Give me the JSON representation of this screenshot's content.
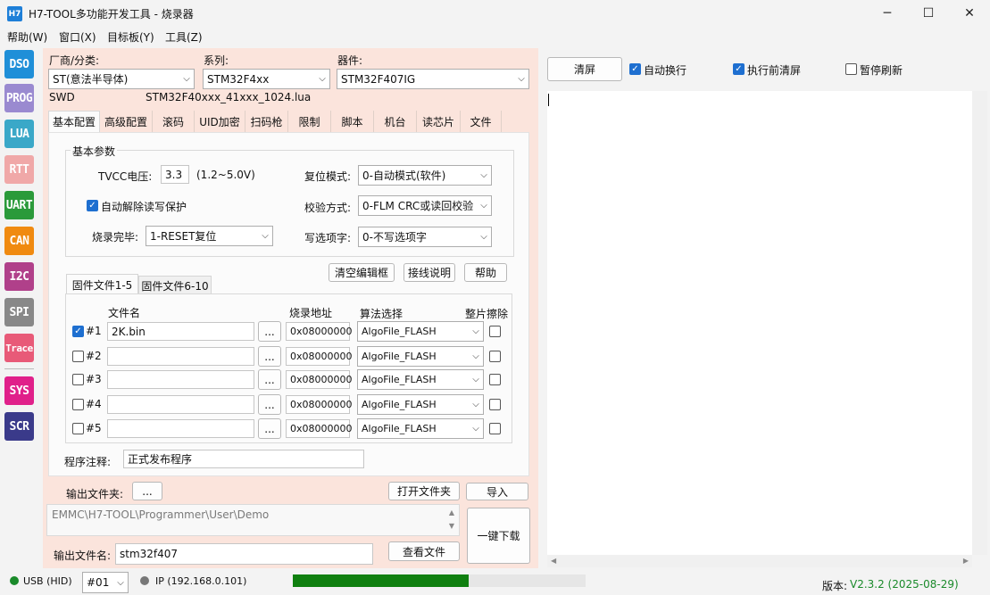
{
  "window": {
    "logo": "H7",
    "title": "H7-TOOL多功能开发工具 - 烧录器",
    "minimize": "─",
    "maximize": "☐",
    "close": "✕"
  },
  "menu": [
    "帮助(W)",
    "窗口(X)",
    "目标板(Y)",
    "工具(Z)"
  ],
  "sidebar": [
    {
      "label": "DSO",
      "color": "#1f8fd8"
    },
    {
      "label": "PROG",
      "color": "#9a8ad0"
    },
    {
      "label": "LUA",
      "color": "#3aa8c8"
    },
    {
      "label": "RTT",
      "color": "#f0a8a8"
    },
    {
      "label": "UART",
      "color": "#2a9a3a"
    },
    {
      "label": "CAN",
      "color": "#f08a10"
    },
    {
      "label": "I2C",
      "color": "#b0408a"
    },
    {
      "label": "SPI",
      "color": "#888888"
    },
    {
      "label": "Trace",
      "color": "#e85a78"
    },
    {
      "label": "SYS",
      "color": "#e0208a"
    },
    {
      "label": "SCR",
      "color": "#3a3a8a"
    }
  ],
  "device": {
    "vendor_label": "厂商/分类:",
    "vendor": "ST(意法半导体)",
    "series_label": "系列:",
    "series": "STM32F4xx",
    "part_label": "器件:",
    "part": "STM32F407IG",
    "interface": "SWD",
    "script": "STM32F40xxx_41xxx_1024.lua"
  },
  "tabs": [
    "基本配置",
    "高级配置",
    "滚码",
    "UID加密",
    "扫码枪",
    "限制",
    "脚本",
    "机台",
    "读芯片",
    "文件"
  ],
  "basic": {
    "group_title": "基本参数",
    "tvcc_label": "TVCC电压:",
    "tvcc": "3.3",
    "tvcc_range": "(1.2~5.0V)",
    "reset_label": "复位模式:",
    "reset": "0-自动模式(软件)",
    "unlock_label": "自动解除读写保护",
    "verify_label": "校验方式:",
    "verify": "0-FLM CRC或读回校验",
    "finish_label": "烧录完毕:",
    "finish": "1-RESET复位",
    "option_label": "写选项字:",
    "option": "0-不写选项字"
  },
  "actions": {
    "clear_editor": "清空编辑框",
    "wiring": "接线说明",
    "help": "帮助"
  },
  "fw_tabs": [
    "固件文件1-5",
    "固件文件6-10"
  ],
  "fw_headers": {
    "file": "文件名",
    "addr": "烧录地址",
    "algo": "算法选择",
    "erase": "整片擦除"
  },
  "fw_rows": [
    {
      "id": "#1",
      "checked": true,
      "file": "2K.bin",
      "browse": "...",
      "addr": "0x08000000",
      "algo": "AlgoFile_FLASH"
    },
    {
      "id": "#2",
      "checked": false,
      "file": "",
      "browse": "...",
      "addr": "0x08000000",
      "algo": "AlgoFile_FLASH"
    },
    {
      "id": "#3",
      "checked": false,
      "file": "",
      "browse": "...",
      "addr": "0x08000000",
      "algo": "AlgoFile_FLASH"
    },
    {
      "id": "#4",
      "checked": false,
      "file": "",
      "browse": "...",
      "addr": "0x08000000",
      "algo": "AlgoFile_FLASH"
    },
    {
      "id": "#5",
      "checked": false,
      "file": "",
      "browse": "...",
      "addr": "0x08000000",
      "algo": "AlgoFile_FLASH"
    }
  ],
  "note_label": "程序注释:",
  "note": "正式发布程序",
  "output": {
    "folder_label": "输出文件夹:",
    "folder_browse": "...",
    "open_folder": "打开文件夹",
    "import": "导入",
    "path": "EMMC\\H7-TOOL\\Programmer\\User\\Demo",
    "name_label": "输出文件名:",
    "name": "stm32f407",
    "view_file": "查看文件",
    "download": "一键下载"
  },
  "right": {
    "clear": "清屏",
    "auto_wrap": "自动换行",
    "clear_before": "执行前清屏",
    "pause": "暂停刷新"
  },
  "status": {
    "usb": "USB (HID)",
    "port": "#01",
    "ip": "IP (192.168.0.101)",
    "progress": 0.6,
    "version_label": "版本:",
    "version": "V2.3.2 (2025-08-29)"
  }
}
